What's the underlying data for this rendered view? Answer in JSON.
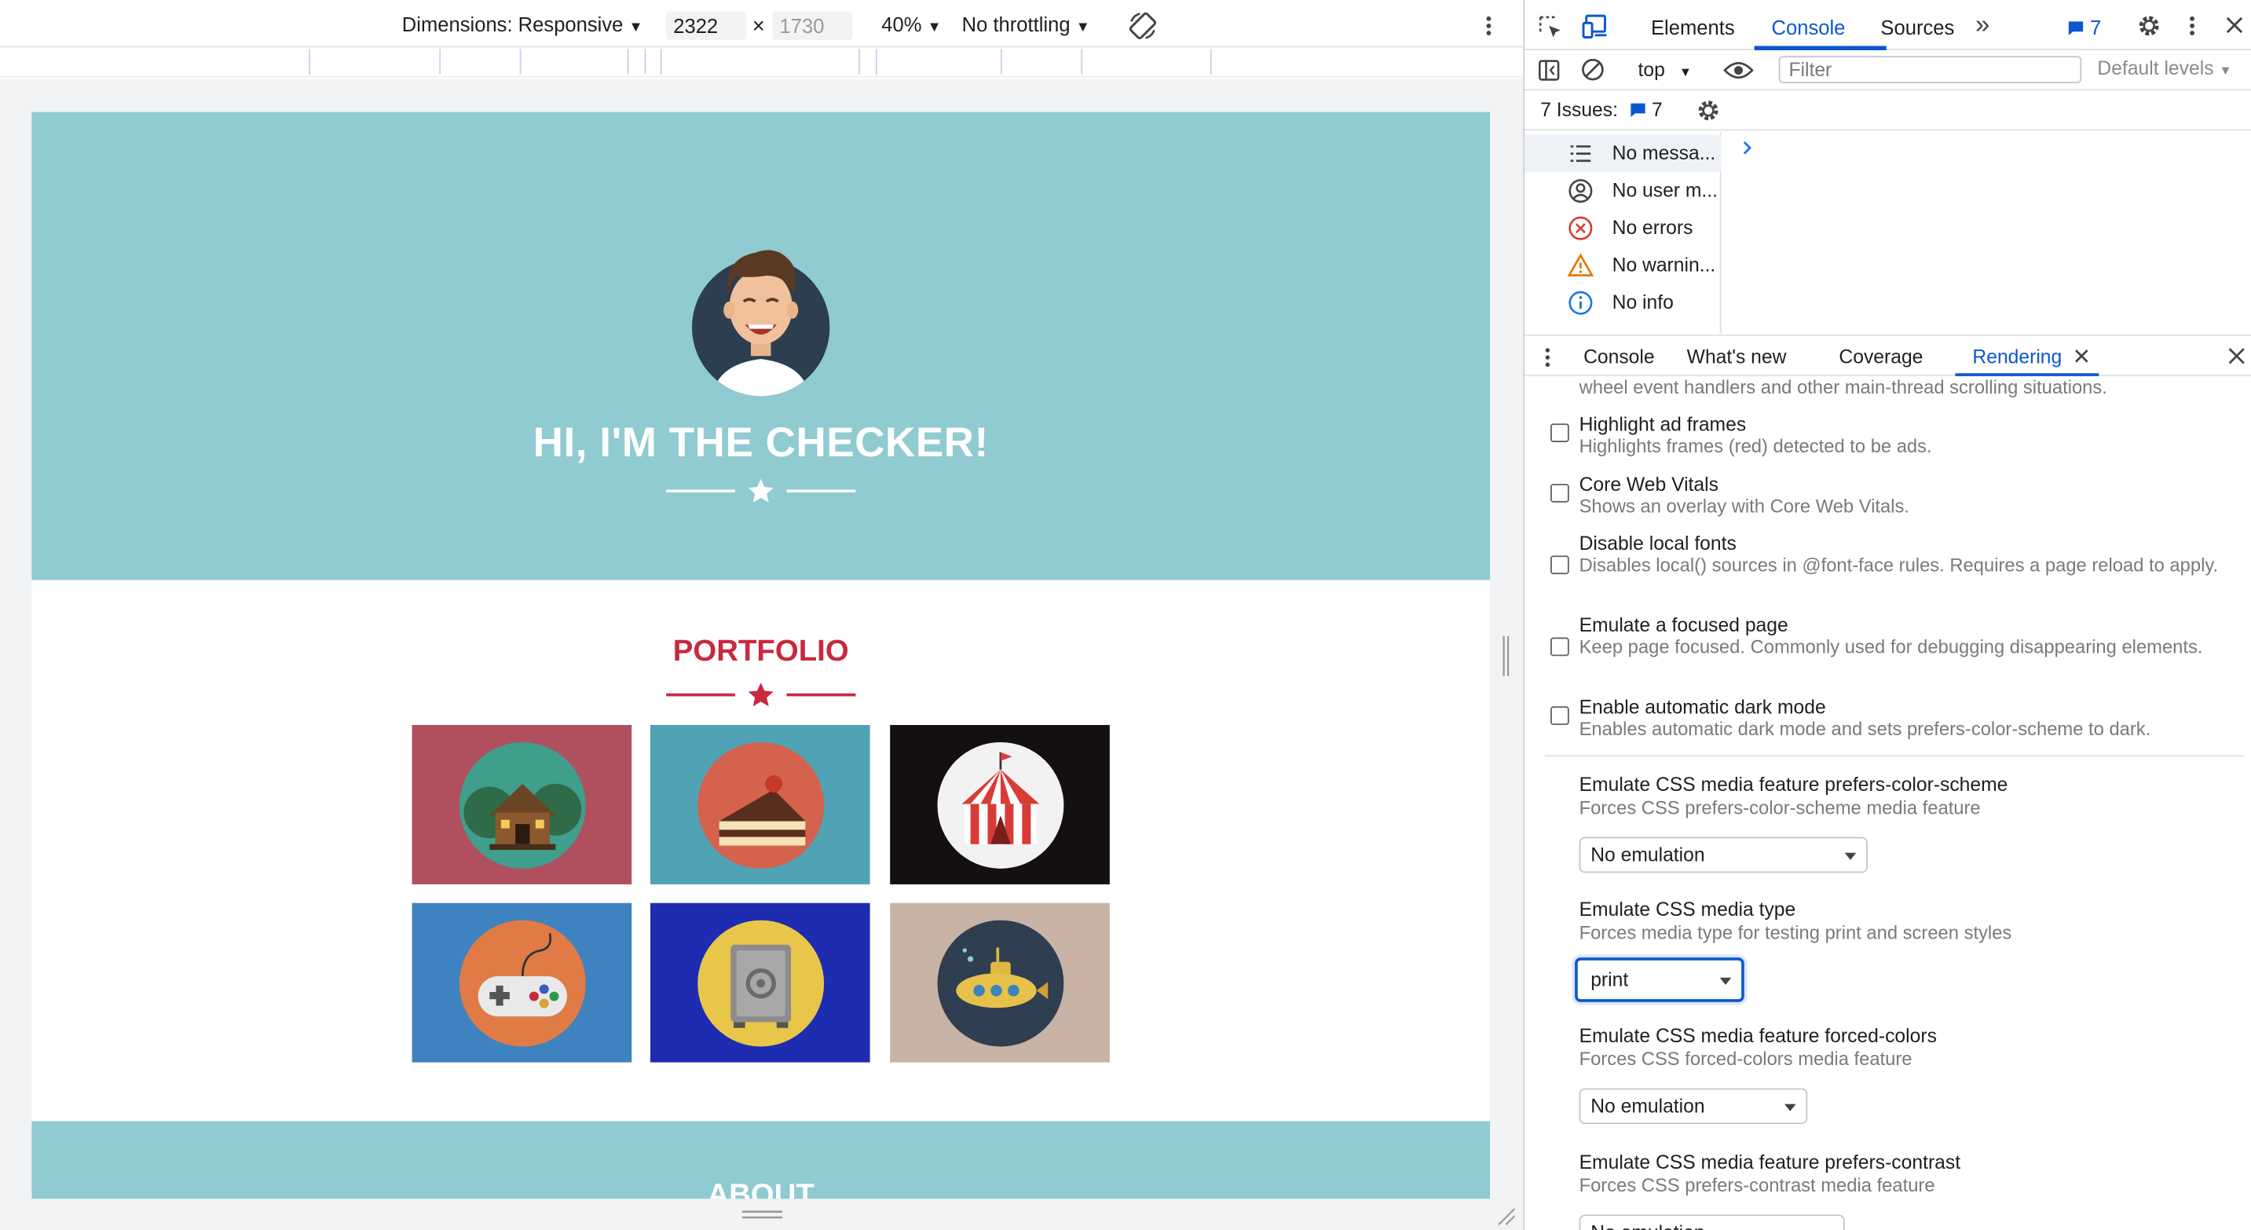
{
  "device_toolbar": {
    "dimensions_label": "Dimensions: Responsive",
    "width": "2322",
    "times": "×",
    "height_placeholder": "1730",
    "zoom": "40%",
    "throttling": "No throttling"
  },
  "page": {
    "hero_title": "HI, I'M THE CHECKER!",
    "portfolio_title": "PORTFOLIO",
    "about_title": "ABOUT",
    "colors": {
      "hero": "#8fcbd0",
      "accent": "#c8293f"
    },
    "tiles": [
      {
        "name": "cabin",
        "bg": "#b0505f"
      },
      {
        "name": "cake",
        "bg": "#4fa3b5"
      },
      {
        "name": "circus",
        "bg": "#141010"
      },
      {
        "name": "game-controller",
        "bg": "#3f82c0"
      },
      {
        "name": "safe",
        "bg": "#1d2cb0"
      },
      {
        "name": "submarine",
        "bg": "#c9b2a6"
      }
    ]
  },
  "devtools": {
    "tabs": {
      "elements": "Elements",
      "console": "Console",
      "sources": "Sources",
      "more": "»"
    },
    "issues_badge": "7",
    "context": "top",
    "filter_placeholder": "Filter",
    "levels": "Default levels",
    "issues_label": "7 Issues:",
    "issues_count": "7",
    "sidebar": [
      {
        "label": "No messa...",
        "icon": "list-icon"
      },
      {
        "label": "No user m...",
        "icon": "user-icon"
      },
      {
        "label": "No errors",
        "icon": "error-icon"
      },
      {
        "label": "No warnin...",
        "icon": "warning-icon"
      },
      {
        "label": "No info",
        "icon": "info-icon"
      }
    ],
    "drawer_tabs": {
      "console": "Console",
      "whats_new": "What's new",
      "coverage": "Coverage",
      "rendering": "Rendering"
    },
    "rendering": {
      "cut_text": "wheel event handlers and other main-thread scrolling situations.",
      "options": [
        {
          "title": "Highlight ad frames",
          "desc": "Highlights frames (red) detected to be ads."
        },
        {
          "title": "Core Web Vitals",
          "desc": "Shows an overlay with Core Web Vitals."
        },
        {
          "title": "Disable local fonts",
          "desc": "Disables local() sources in @font-face rules. Requires a page reload to apply."
        },
        {
          "title": "Emulate a focused page",
          "desc": "Keep page focused. Commonly used for debugging disappearing elements."
        },
        {
          "title": "Enable automatic dark mode",
          "desc": "Enables automatic dark mode and sets prefers-color-scheme to dark."
        }
      ],
      "media": [
        {
          "title": "Emulate CSS media feature prefers-color-scheme",
          "desc": "Forces CSS prefers-color-scheme media feature",
          "value": "No emulation"
        },
        {
          "title": "Emulate CSS media type",
          "desc": "Forces media type for testing print and screen styles",
          "value": "print"
        },
        {
          "title": "Emulate CSS media feature forced-colors",
          "desc": "Forces CSS forced-colors media feature",
          "value": "No emulation"
        },
        {
          "title": "Emulate CSS media feature prefers-contrast",
          "desc": "Forces CSS prefers-contrast media feature",
          "value": "No emulation"
        }
      ]
    }
  }
}
